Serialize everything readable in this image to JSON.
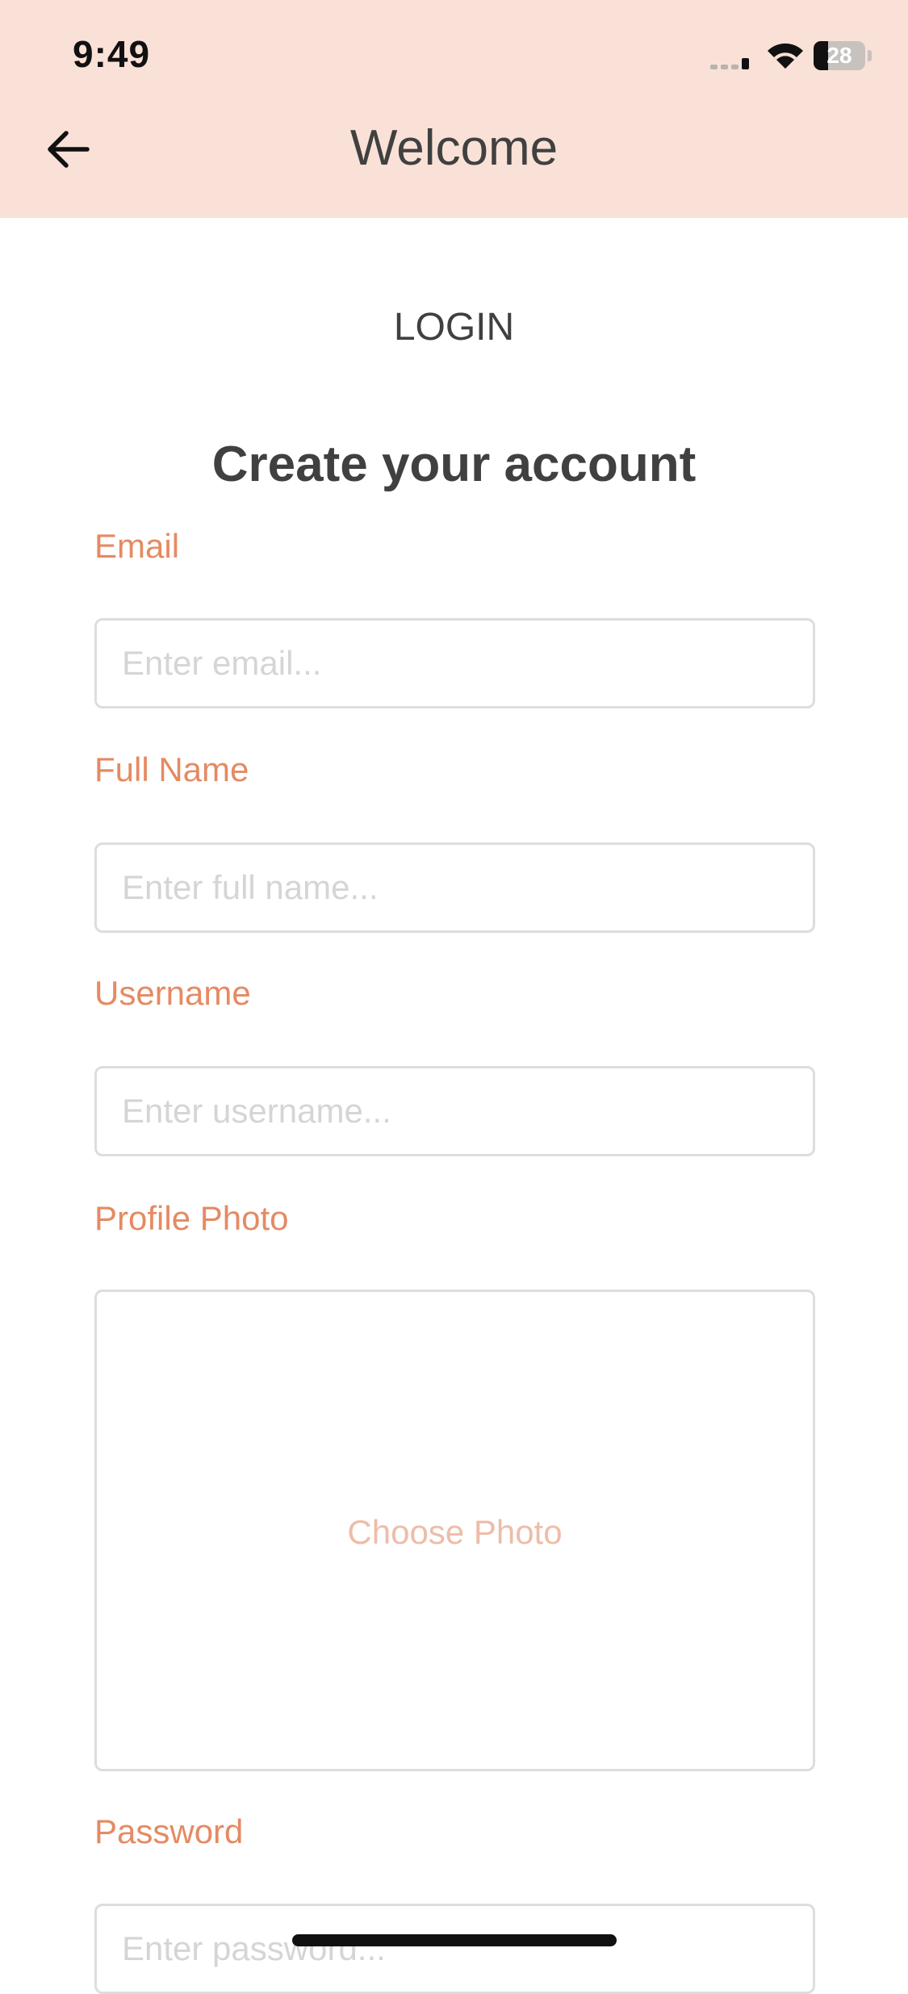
{
  "status_bar": {
    "time": "9:49",
    "battery": "28",
    "battery_level": 0.28,
    "icons": [
      "cellular-signal-icon",
      "wifi-icon",
      "battery-icon"
    ]
  },
  "header": {
    "title": "Welcome",
    "back_icon": "arrow-left-icon",
    "background": "#FAE1D7"
  },
  "login_tab": "LOGIN",
  "form": {
    "title": "Create your account",
    "email_label": "Email",
    "email_value": "",
    "email_placeholder": "Enter email...",
    "fullname_label": "Full Name",
    "fullname_value": "",
    "fullname_placeholder": "Enter full name...",
    "username_label": "Username",
    "username_value": "",
    "username_placeholder": "Enter username...",
    "photo_label": "Profile Photo",
    "choose_photo": "Choose Photo",
    "password_label": "Password",
    "password_value": "",
    "password_placeholder": "Enter password..."
  },
  "colors": {
    "accent": "#E58A63",
    "text": "#404040",
    "placeholder": "#D5D5D5",
    "border": "#DDDDDD"
  }
}
